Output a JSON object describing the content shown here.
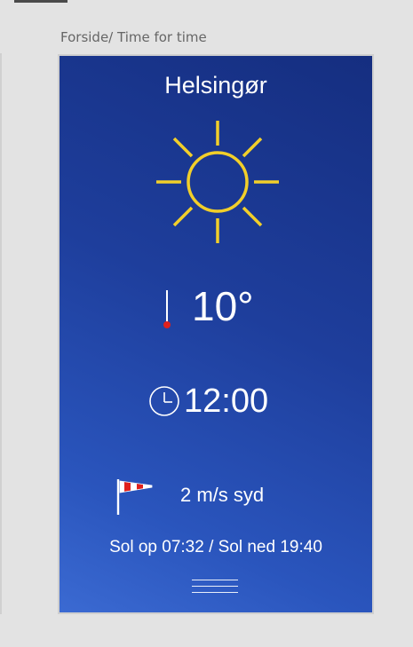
{
  "breadcrumb": {
    "text": "Forside/ Time for time"
  },
  "weather": {
    "city": "Helsingør",
    "condition_icon": "sun-icon",
    "temperature": "10°",
    "time": "12:00",
    "wind": "2 m/s syd",
    "sun_times": "Sol op 07:32 / Sol ned 19:40"
  },
  "icons": {
    "thermometer": "thermometer-icon",
    "clock": "clock-icon",
    "wind": "windsock-icon",
    "menu": "hamburger-menu-icon"
  },
  "colors": {
    "background_top": "#152e80",
    "background_bottom": "#3b6ad2",
    "sun": "#f2cf2a",
    "thermometer_bulb": "#e0201c",
    "windsock_stripe": "#e0201c",
    "text": "#ffffff"
  }
}
